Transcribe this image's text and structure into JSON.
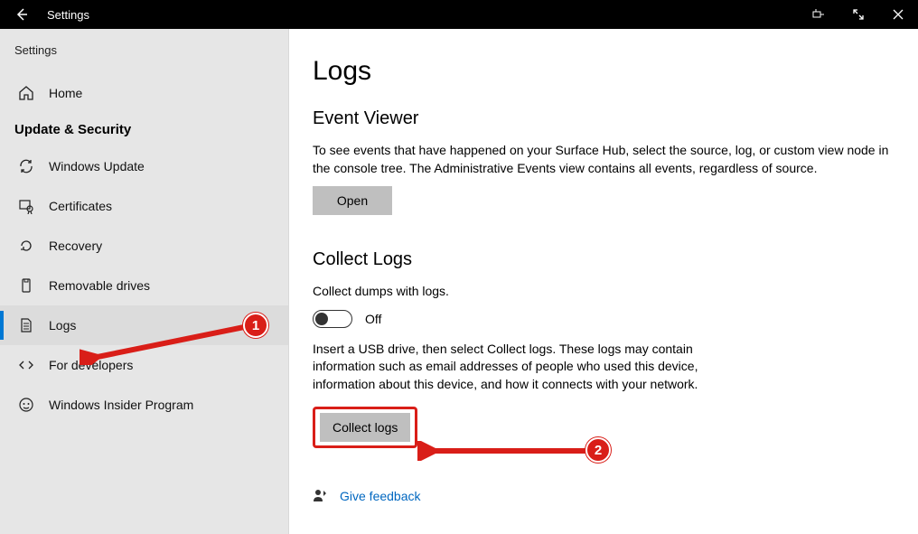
{
  "titlebar": {
    "title": "Settings"
  },
  "sidebar": {
    "crumb": "Settings",
    "home_label": "Home",
    "section_title": "Update & Security",
    "items": [
      {
        "label": "Windows Update"
      },
      {
        "label": "Certificates"
      },
      {
        "label": "Recovery"
      },
      {
        "label": "Removable drives"
      },
      {
        "label": "Logs"
      },
      {
        "label": "For developers"
      },
      {
        "label": "Windows Insider Program"
      }
    ]
  },
  "main": {
    "page_title": "Logs",
    "ev_heading": "Event Viewer",
    "ev_body": "To see events that have happened on your Surface Hub, select the source, log, or custom view node in the console tree. The Administrative Events view contains all events, regardless of source.",
    "open_label": "Open",
    "cl_heading": "Collect Logs",
    "cl_dumps_label": "Collect dumps with logs.",
    "toggle_state": "Off",
    "cl_body": "Insert a USB drive, then select Collect logs. These logs may contain information such as email addresses of people who used this device, information about this device, and how it connects with your network.",
    "collect_label": "Collect logs",
    "feedback_label": "Give feedback"
  },
  "annotations": {
    "one": "1",
    "two": "2"
  }
}
